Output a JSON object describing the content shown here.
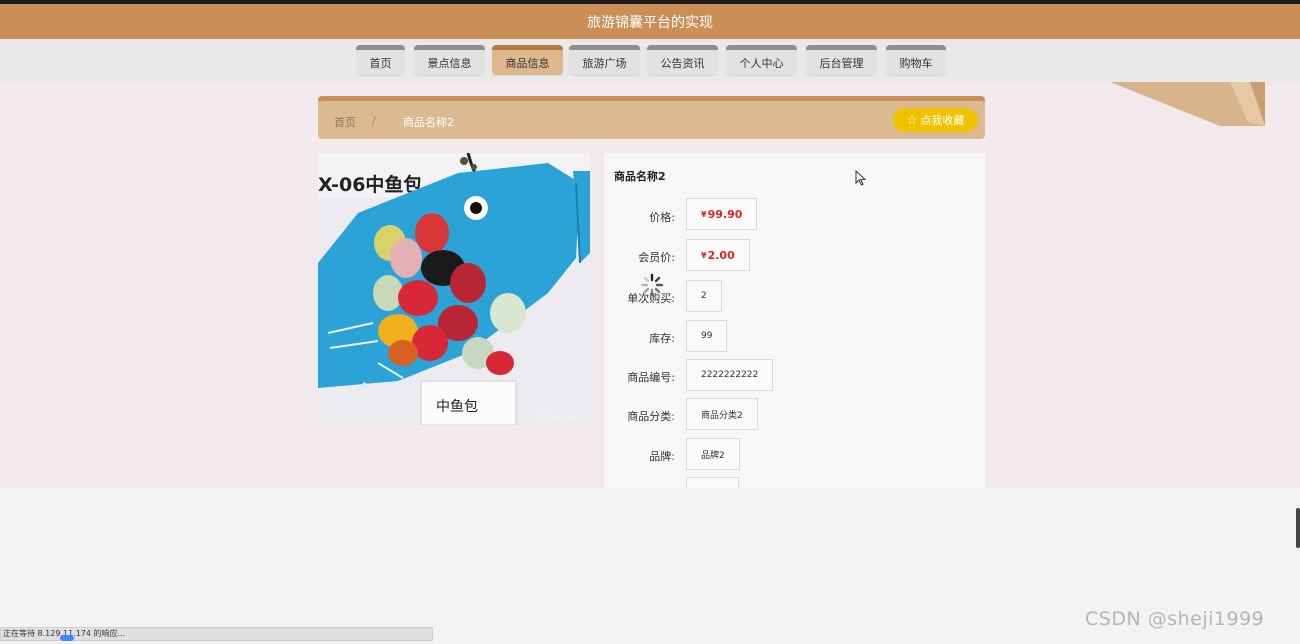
{
  "header": {
    "title": "旅游锦囊平台的实现"
  },
  "nav": {
    "items": [
      {
        "label": "首页",
        "active": false
      },
      {
        "label": "景点信息",
        "active": false
      },
      {
        "label": "商品信息",
        "active": true
      },
      {
        "label": "旅游广场",
        "active": false
      },
      {
        "label": "公告资讯",
        "active": false
      },
      {
        "label": "个人中心",
        "active": false
      },
      {
        "label": "后台管理",
        "active": false
      },
      {
        "label": "购物车",
        "active": false
      }
    ]
  },
  "breadcrumb": {
    "home": "首页",
    "separator": "/",
    "current": "商品名称2"
  },
  "favorite_button": {
    "label": "点我收藏",
    "icon": "star-outline-icon"
  },
  "product_image": {
    "caption": "X-06中鱼包",
    "tag_text": "中鱼包",
    "image_watermark": "淮玉报(个体"
  },
  "product": {
    "name": "商品名称2",
    "currency_symbol": "¥",
    "fields": {
      "price": {
        "label": "价格:",
        "value": "99.90"
      },
      "member_price": {
        "label": "会员价:",
        "value": "2.00"
      },
      "single_purchase": {
        "label": "单次购买:",
        "value": "2"
      },
      "stock": {
        "label": "库存:",
        "value": "99"
      },
      "code": {
        "label": "商品编号:",
        "value": "2222222222"
      },
      "category": {
        "label": "商品分类:",
        "value": "商品分类2"
      },
      "brand": {
        "label": "品牌:",
        "value": "品牌2"
      }
    }
  },
  "status_bar": {
    "text": "正在等待 8.129.11.174 的响应..."
  },
  "watermark": "CSDN @sheji1999",
  "colors": {
    "header_bg": "#c98f57",
    "nav_active": "#dcb88c",
    "breadcrumb_bg": "#dcba91",
    "favorite_bg": "#f0c300",
    "price_red": "#e1251b",
    "page_bg": "#f1e9ec"
  }
}
